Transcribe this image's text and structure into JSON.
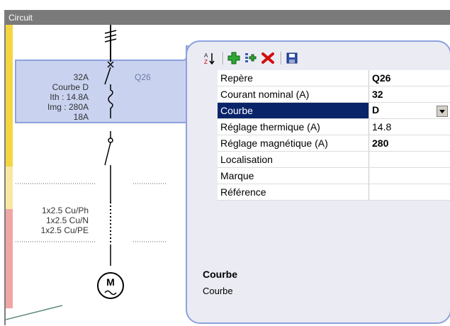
{
  "window": {
    "title": "Circuit"
  },
  "labels": {
    "breaker_rating": "32A",
    "breaker_tag": "Q26",
    "curve": "Courbe D",
    "ith": "Ith : 14.8A",
    "img": "Img : 280A",
    "switch_rating": "18A",
    "cable_ph": "1x2.5 Cu/Ph",
    "cable_n": "1x2.5 Cu/N",
    "cable_pe": "1x2.5 Cu/PE",
    "motor": "M"
  },
  "properties": [
    {
      "name": "Repère",
      "value": "Q26",
      "bold": true
    },
    {
      "name": "Courant nominal (A)",
      "value": "32",
      "bold": true
    },
    {
      "name": "Courbe",
      "value": "D",
      "bold": true,
      "selected": true,
      "dropdown": true
    },
    {
      "name": "Réglage thermique (A)",
      "value": "14.8",
      "bold": false
    },
    {
      "name": "Réglage magnétique (A)",
      "value": "280",
      "bold": true
    },
    {
      "name": "Localisation",
      "value": "",
      "bold": false
    },
    {
      "name": "Marque",
      "value": "",
      "bold": false
    },
    {
      "name": "Référence",
      "value": "",
      "bold": false
    }
  ],
  "description": {
    "title": "Courbe",
    "text": "Courbe"
  },
  "toolbar": [
    "sort-az-icon",
    "add-icon",
    "add-multiple-icon",
    "delete-icon",
    "save-icon"
  ],
  "colors": {
    "accent": "#8da2dd",
    "selected_row": "#0a246a",
    "yellow_bar": "#f4d640",
    "red_bar": "#f1a6a6"
  }
}
